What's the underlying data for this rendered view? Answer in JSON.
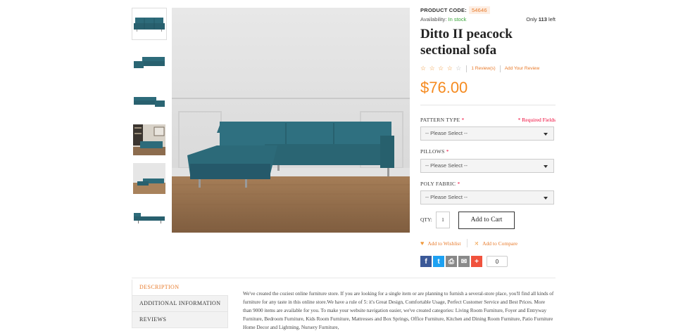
{
  "gallery": {
    "thumbnails": [
      {
        "name": "thumbnail-front"
      },
      {
        "name": "thumbnail-angle-left"
      },
      {
        "name": "thumbnail-angle-right"
      },
      {
        "name": "thumbnail-room"
      },
      {
        "name": "thumbnail-room-wide"
      },
      {
        "name": "thumbnail-side"
      }
    ]
  },
  "product": {
    "code_label": "PRODUCT CODE:",
    "code_value": "54646",
    "availability_label": "Availability:",
    "availability_value": "In stock",
    "only_prefix": "Only",
    "only_count": "113",
    "only_suffix": "left",
    "title": "Ditto II peacock sectional sofa",
    "stars_filled": "☆ ☆ ☆ ☆",
    "stars_empty": "☆",
    "reviews_link": "1 Review(s)",
    "add_review_link": "Add Your Review",
    "price": "$76.00"
  },
  "options": {
    "required_note": "* Required Fields",
    "pattern_label": "PATTERN TYPE",
    "pillows_label": "PILLOWS",
    "fabric_label": "POLY FABRIC",
    "required_mark": "*",
    "select_placeholder": "-- Please Select --"
  },
  "purchase": {
    "qty_label": "QTY:",
    "qty_value": "1",
    "add_to_cart": "Add to Cart",
    "wishlist": "Add to Wishlist",
    "compare": "Add to Compare"
  },
  "share": {
    "count": "0"
  },
  "tabs": [
    {
      "label": "DESCRIPTION"
    },
    {
      "label": "ADDITIONAL INFORMATION"
    },
    {
      "label": "REVIEWS"
    }
  ],
  "description": "We've created the coziest online furniture store. If you are looking for a single item or are planning to furnish a several-store place, you'll find all kinds of furniture for any taste in this online store.We have a rule of 5: it's Great Design, Comfortable Usage, Perfect Customer Service and Best Prices. More than 9000 items are available for you. To make your website navigation easier, we've created categories: Living Room Furniture, Foyer and Entryway Furniture, Bedroom Furniture, Kids Room Furniture, Mattresses and Box Springs, Office Furniture, Kitchen and Dining Room Furniture, Patio Furniture Home Decor and Lightning, Nursery Furniture,",
  "colors": {
    "accent": "#f58a1f",
    "sofa": "#2d6b7a"
  }
}
